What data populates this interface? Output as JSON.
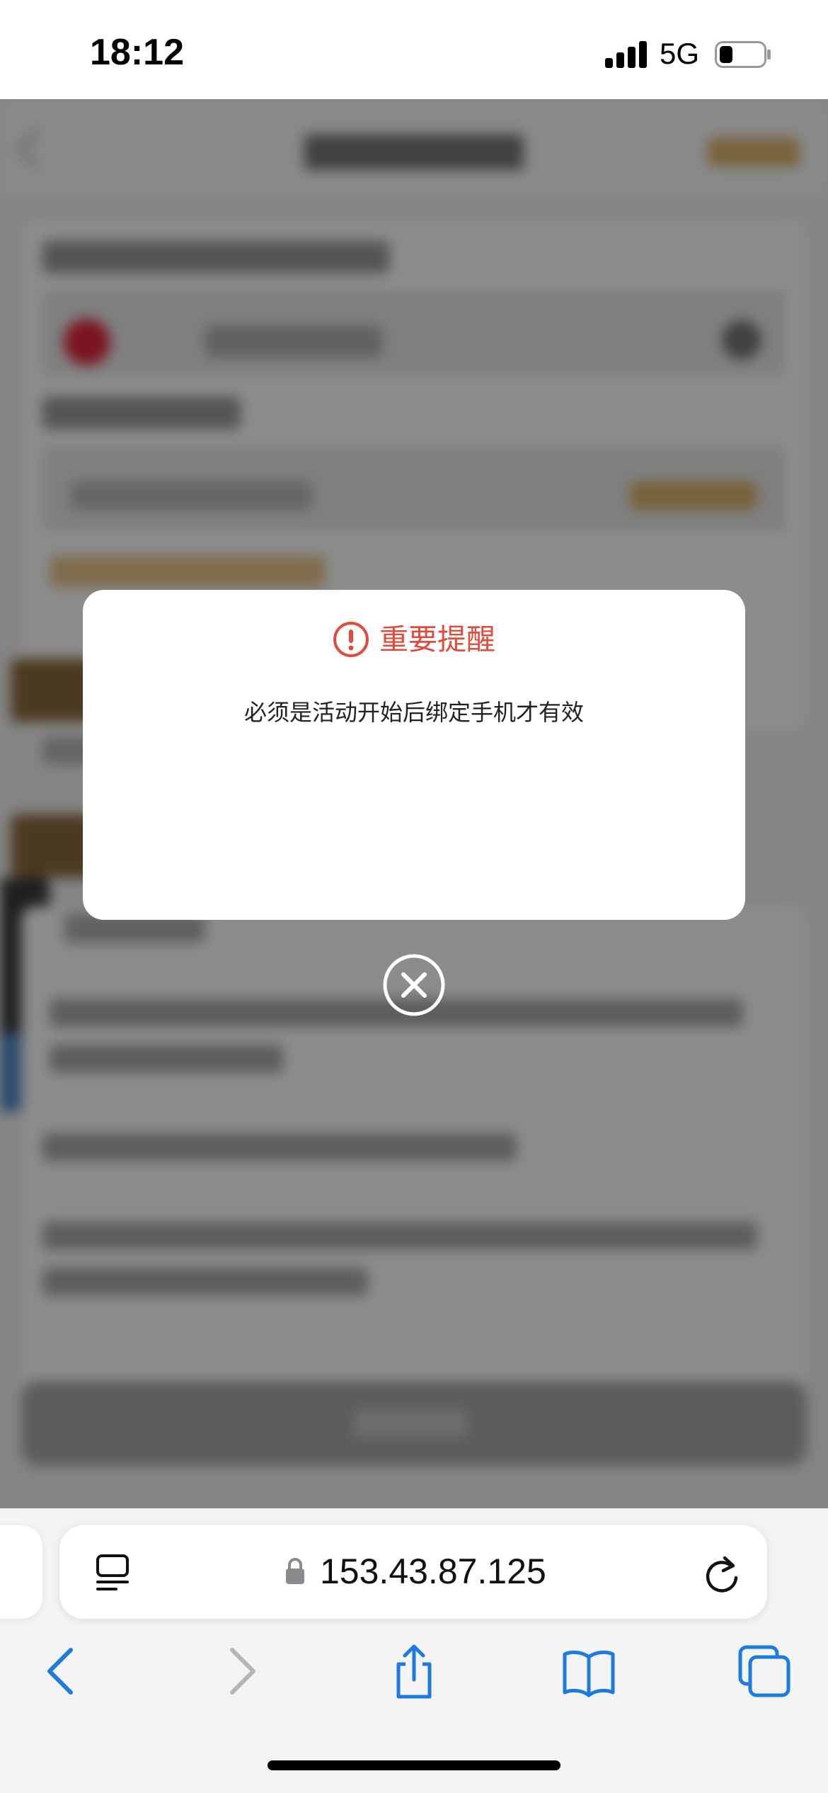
{
  "status_bar": {
    "time": "18:12",
    "network": "5G",
    "battery_level": 0.3
  },
  "dialog": {
    "title": "重要提醒",
    "message": "必须是活动开始后绑定手机才有效",
    "title_color": "#e24a3b"
  },
  "browser": {
    "url": "153.43.87.125",
    "accent_color": "#1f7ae0"
  }
}
